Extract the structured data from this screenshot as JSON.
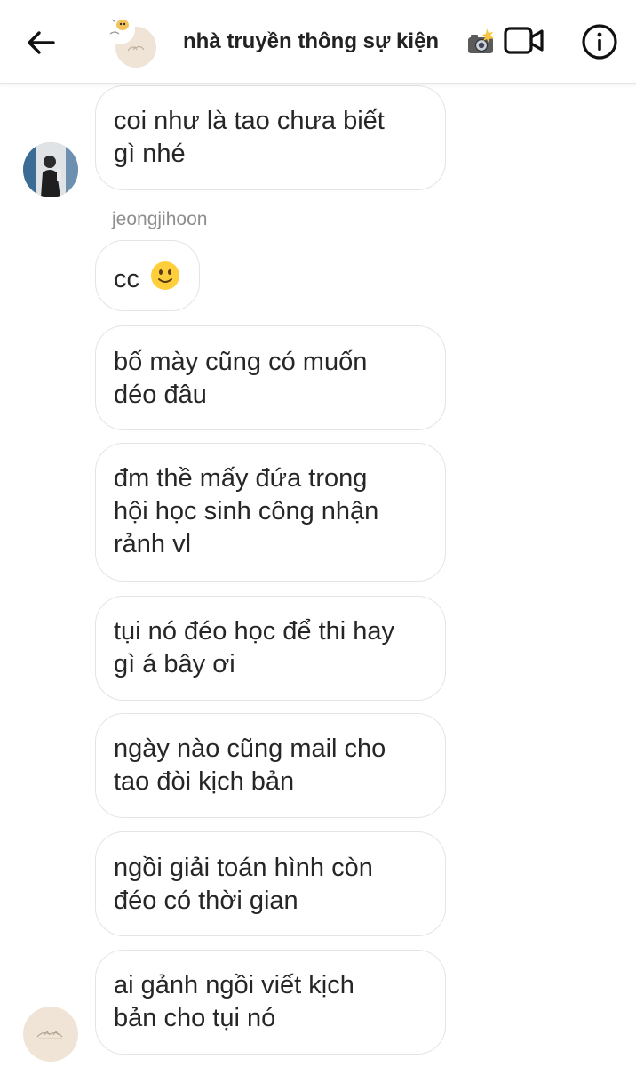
{
  "header": {
    "title": "nhà truyền thông sự kiện",
    "icons": [
      "back-arrow-icon",
      "camera-flash-emoji-icon",
      "video-call-icon",
      "info-icon"
    ]
  },
  "messages": [
    {
      "text_lines": [
        "coi như là tao chưa biết",
        "gì nhé"
      ]
    },
    {
      "sender": "jeongjihoon",
      "text": "cc",
      "emoji": "🙂"
    },
    {
      "text_lines": [
        "bố mày cũng có muốn",
        "déo đâu"
      ]
    },
    {
      "text_lines": [
        "đm thề mấy đứa trong",
        "hội học sinh công nhận",
        "rảnh vl"
      ]
    },
    {
      "text_lines": [
        "tụi nó đéo học để thi hay",
        "gì á bây ơi"
      ]
    },
    {
      "text_lines": [
        "ngày nào cũng mail cho",
        "tao đòi kịch bản"
      ]
    },
    {
      "text_lines": [
        "ngồi giải toán hình còn",
        "đéo có thời gian"
      ]
    },
    {
      "text_lines": [
        "ai gảnh ngồi viết kịch",
        "bản cho tụi nó"
      ]
    }
  ],
  "colors": {
    "bubble_border": "#e4e4e4",
    "text": "#262626",
    "sender": "#8e8e8e",
    "avatar_beige": "#efe4d6"
  }
}
